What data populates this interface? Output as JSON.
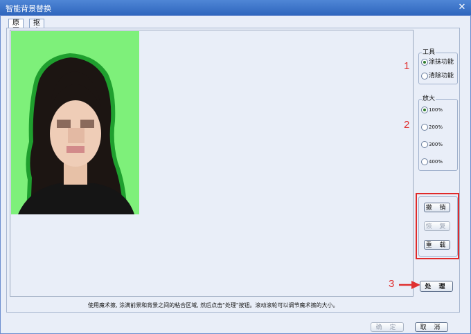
{
  "window": {
    "title": "智能背景替换",
    "close_glyph": "✕"
  },
  "tabs": [
    {
      "label": "原图"
    },
    {
      "label": "抠出后"
    }
  ],
  "tools": {
    "legend": "工具",
    "options": [
      {
        "label": "涂抹功能",
        "checked": true
      },
      {
        "label": "清除功能",
        "checked": false
      }
    ]
  },
  "zoom": {
    "legend": "放大",
    "options": [
      {
        "label": "100%",
        "checked": true
      },
      {
        "label": "200%",
        "checked": false
      },
      {
        "label": "300%",
        "checked": false
      },
      {
        "label": "400%",
        "checked": false
      }
    ]
  },
  "history": {
    "undo_label": "撤 销",
    "redo_label": "恢 复",
    "reload_label": "重 载"
  },
  "process_button": "处 理",
  "annotations": {
    "n1": "1",
    "n2": "2",
    "n3": "3"
  },
  "hint": "使用魔术擦, 涂满前景和背景之间的粘合区域, 然后点击\"处理\"按钮。滚动滚轮可以调节魔术擦的大小。",
  "footer": {
    "ok_label": "确 定",
    "cancel_label": "取 消"
  },
  "colors": {
    "background_green": "#7ef07a",
    "outline_green": "#1f9f2e",
    "annotation_red": "#e03030",
    "title_blue": "#2f66bd"
  },
  "icons": {
    "arrow": "red-arrow-icon",
    "radio": "radio-icon"
  }
}
